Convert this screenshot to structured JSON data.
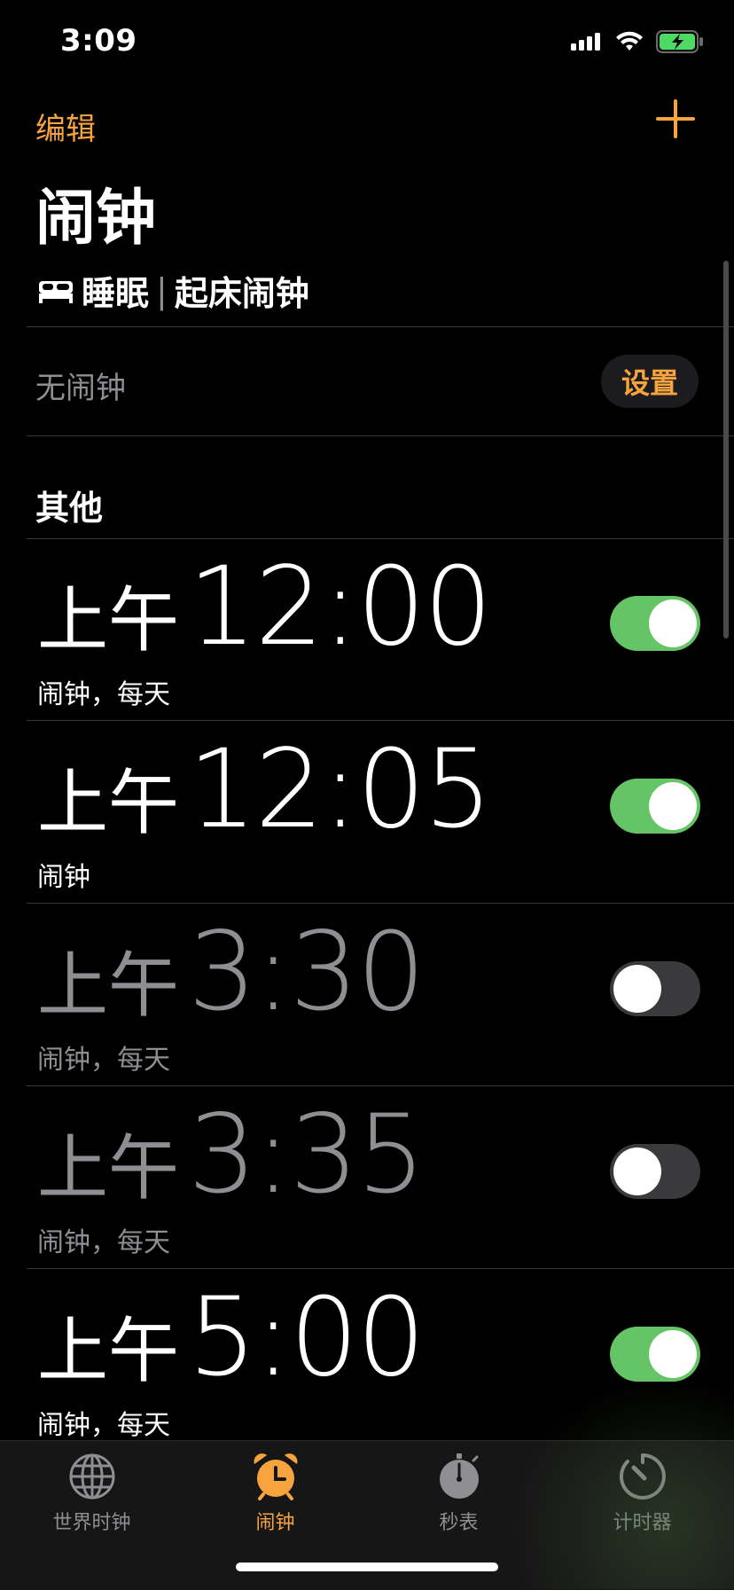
{
  "status_bar": {
    "time": "3:09"
  },
  "nav": {
    "edit_label": "编辑",
    "title": "闹钟"
  },
  "sleep": {
    "title_left": "睡眠",
    "separator": "|",
    "title_right": "起床闹钟",
    "no_alarm": "无闹钟",
    "setup_label": "设置"
  },
  "section": {
    "other_title": "其他"
  },
  "alarms": [
    {
      "ampm": "上午",
      "time": "12:00",
      "label": "闹钟，每天",
      "enabled": true
    },
    {
      "ampm": "上午",
      "time": "12:05",
      "label": "闹钟",
      "enabled": true
    },
    {
      "ampm": "上午",
      "time": "3:30",
      "label": "闹钟，每天",
      "enabled": false
    },
    {
      "ampm": "上午",
      "time": "3:35",
      "label": "闹钟，每天",
      "enabled": false
    },
    {
      "ampm": "上午",
      "time": "5:00",
      "label": "闹钟，每天",
      "enabled": true
    }
  ],
  "tabs": [
    {
      "label": "世界时钟",
      "icon": "globe-icon",
      "active": false
    },
    {
      "label": "闹钟",
      "icon": "alarm-clock-icon",
      "active": true
    },
    {
      "label": "秒表",
      "icon": "stopwatch-icon",
      "active": false
    },
    {
      "label": "计时器",
      "icon": "timer-icon",
      "active": false
    }
  ],
  "colors": {
    "accent": "#f7a33e",
    "toggle_on": "#65c466",
    "toggle_off": "#3a3a3c",
    "secondary_text": "#8e8e93"
  }
}
